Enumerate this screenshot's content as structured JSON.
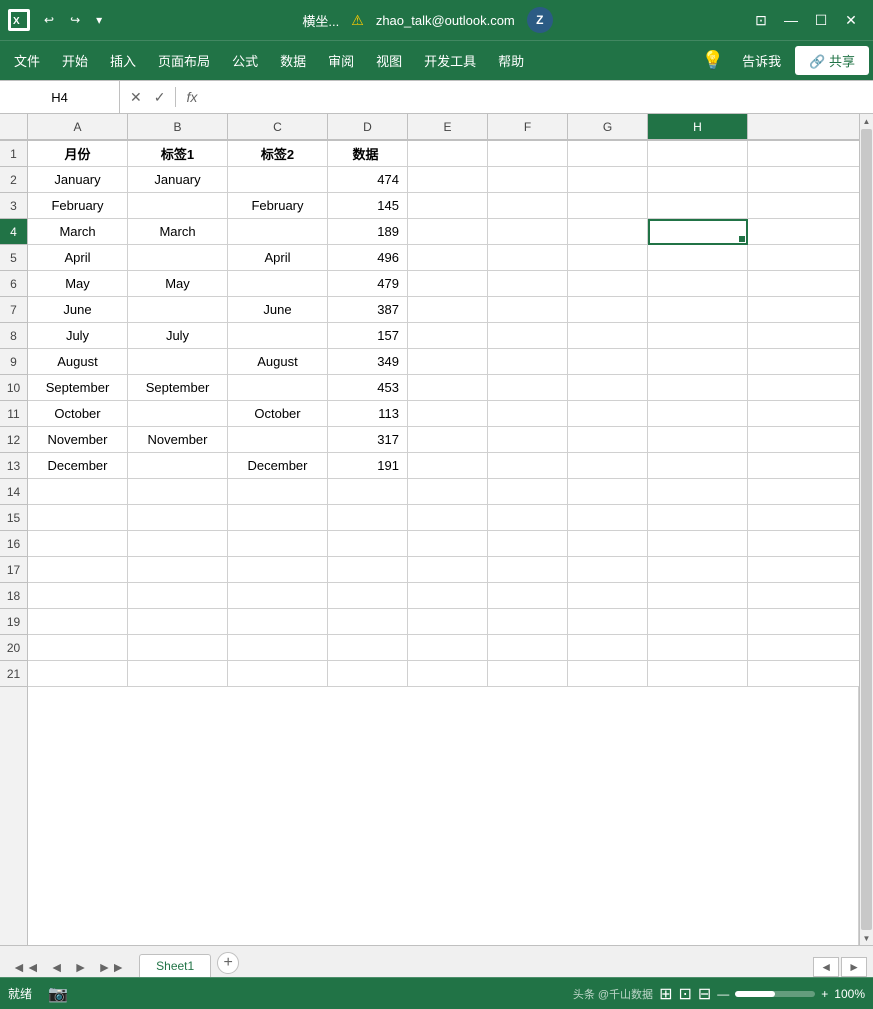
{
  "titlebar": {
    "icon_label": "Excel icon",
    "undo_label": "↩",
    "redo_label": "↪",
    "title": "横坐...",
    "warning_symbol": "⚠",
    "email": "zhao_talk@outlook.com",
    "avatar_letter": "Z",
    "btn_fullscreen": "⊡",
    "btn_minimize": "—",
    "btn_restore": "☐",
    "btn_close": "✕"
  },
  "menubar": {
    "items": [
      "文件",
      "开始",
      "插入",
      "页面布局",
      "公式",
      "数据",
      "审阅",
      "视图",
      "开发工具",
      "帮助"
    ],
    "tell_me": "告诉我",
    "share_label": "🔗 共享"
  },
  "formulabar": {
    "cell_ref": "H4",
    "cancel_label": "✕",
    "confirm_label": "✓",
    "fx_label": "fx"
  },
  "columns": {
    "headers": [
      "A",
      "B",
      "C",
      "D",
      "E",
      "F",
      "G",
      "H"
    ],
    "widths": [
      100,
      100,
      100,
      80,
      80,
      80,
      80,
      100
    ]
  },
  "rows": {
    "count": 21,
    "headers": [
      "1",
      "2",
      "3",
      "4",
      "5",
      "6",
      "7",
      "8",
      "9",
      "10",
      "11",
      "12",
      "13",
      "14",
      "15",
      "16",
      "17",
      "18",
      "19",
      "20",
      "21"
    ]
  },
  "cells": {
    "row1": {
      "a": "月份",
      "b": "标签1",
      "c": "标签2",
      "d": "数据"
    },
    "row2": {
      "a": "January",
      "b": "January",
      "c": "",
      "d": "474"
    },
    "row3": {
      "a": "February",
      "b": "",
      "c": "February",
      "d": "145"
    },
    "row4": {
      "a": "March",
      "b": "March",
      "c": "",
      "d": "189"
    },
    "row5": {
      "a": "April",
      "b": "",
      "c": "April",
      "d": "496"
    },
    "row6": {
      "a": "May",
      "b": "May",
      "c": "",
      "d": "479"
    },
    "row7": {
      "a": "June",
      "b": "",
      "c": "June",
      "d": "387"
    },
    "row8": {
      "a": "July",
      "b": "July",
      "c": "",
      "d": "157"
    },
    "row9": {
      "a": "August",
      "b": "",
      "c": "August",
      "d": "349"
    },
    "row10": {
      "a": "September",
      "b": "September",
      "c": "",
      "d": "453"
    },
    "row11": {
      "a": "October",
      "b": "",
      "c": "October",
      "d": "113"
    },
    "row12": {
      "a": "November",
      "b": "November",
      "c": "",
      "d": "317"
    },
    "row13": {
      "a": "December",
      "b": "",
      "c": "December",
      "d": "191"
    }
  },
  "selected_cell": "H4",
  "sheet_tab": "Sheet1",
  "add_sheet_label": "+",
  "status": {
    "ready": "就绪",
    "zoom": "100%"
  },
  "watermark": "头条 @千山数据"
}
